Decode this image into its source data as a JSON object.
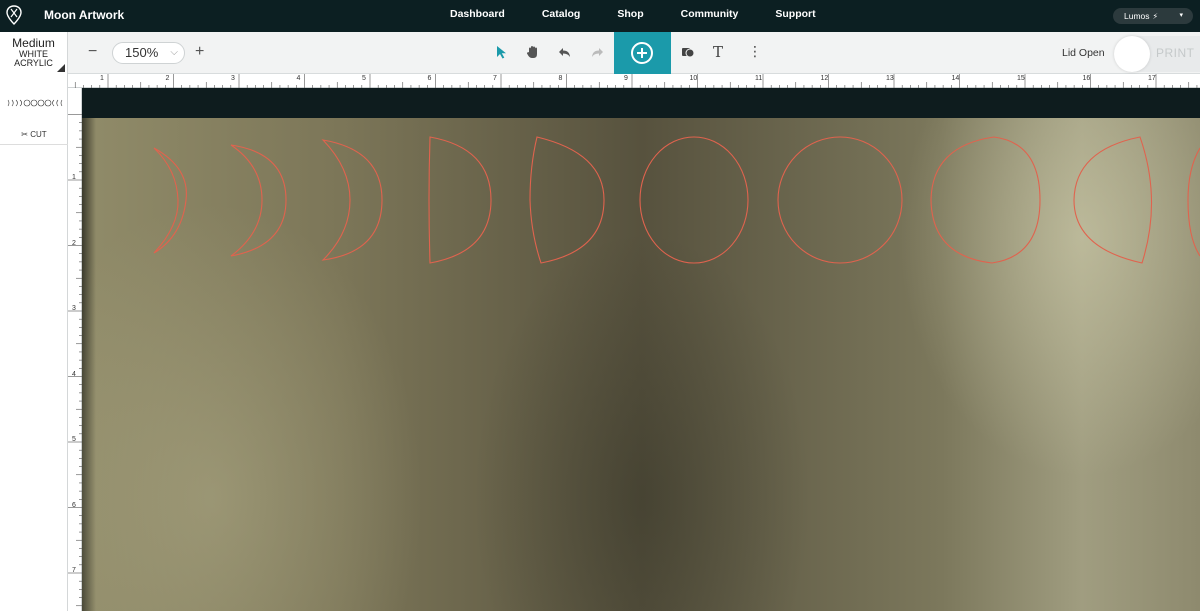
{
  "app": {
    "title": "Moon Artwork"
  },
  "nav": {
    "links": [
      "Dashboard",
      "Catalog",
      "Shop",
      "Community",
      "Support"
    ]
  },
  "user": {
    "name": "Lumos",
    "bolt": "⚡",
    "caret": "▾"
  },
  "material": {
    "thickness": "Medium",
    "line1": "WHITE",
    "line2": "ACRYLIC"
  },
  "toolbar": {
    "zoom_out": "−",
    "zoom_value": "150%",
    "zoom_in": "+",
    "text_tool": "T",
    "more": "⋮",
    "lid_status": "Lid Open",
    "print_label": "PRINT"
  },
  "left_panel": {
    "cut_label": "CUT",
    "cut_icon": "scissors-icon"
  },
  "rulers": {
    "horizontal": [
      "1",
      "2",
      "3",
      "4",
      "5",
      "6",
      "7",
      "8",
      "9",
      "10",
      "11",
      "12",
      "13",
      "14",
      "15",
      "16",
      "17"
    ],
    "vertical": [
      "1",
      "2",
      "3",
      "4",
      "5",
      "6",
      "7"
    ]
  },
  "design": {
    "shape_count": 9,
    "stroke_color": "#e0634e",
    "phases": [
      "waxing-crescent-thin",
      "waxing-crescent",
      "waxing-crescent-wide",
      "first-quarter",
      "waxing-gibbous",
      "full",
      "full",
      "waning-gibbous",
      "waning-gibbous-thin"
    ]
  },
  "colors": {
    "nav_bg": "#0c1f22",
    "accent": "#1b9aaa",
    "cut_stroke": "#e0634e"
  }
}
